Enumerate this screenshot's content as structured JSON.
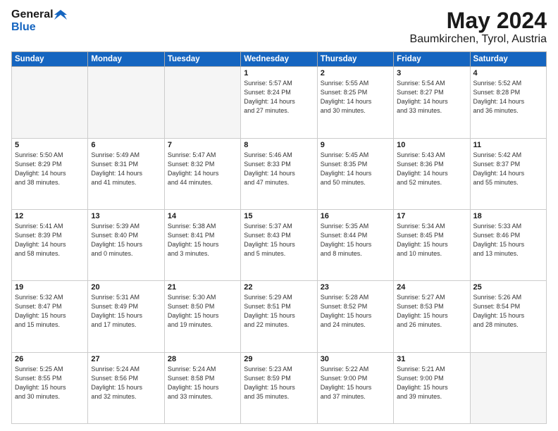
{
  "logo": {
    "text_general": "General",
    "text_blue": "Blue"
  },
  "header": {
    "title": "May 2024",
    "subtitle": "Baumkirchen, Tyrol, Austria"
  },
  "weekdays": [
    "Sunday",
    "Monday",
    "Tuesday",
    "Wednesday",
    "Thursday",
    "Friday",
    "Saturday"
  ],
  "weeks": [
    [
      {
        "day": "",
        "info": ""
      },
      {
        "day": "",
        "info": ""
      },
      {
        "day": "",
        "info": ""
      },
      {
        "day": "1",
        "info": "Sunrise: 5:57 AM\nSunset: 8:24 PM\nDaylight: 14 hours\nand 27 minutes."
      },
      {
        "day": "2",
        "info": "Sunrise: 5:55 AM\nSunset: 8:25 PM\nDaylight: 14 hours\nand 30 minutes."
      },
      {
        "day": "3",
        "info": "Sunrise: 5:54 AM\nSunset: 8:27 PM\nDaylight: 14 hours\nand 33 minutes."
      },
      {
        "day": "4",
        "info": "Sunrise: 5:52 AM\nSunset: 8:28 PM\nDaylight: 14 hours\nand 36 minutes."
      }
    ],
    [
      {
        "day": "5",
        "info": "Sunrise: 5:50 AM\nSunset: 8:29 PM\nDaylight: 14 hours\nand 38 minutes."
      },
      {
        "day": "6",
        "info": "Sunrise: 5:49 AM\nSunset: 8:31 PM\nDaylight: 14 hours\nand 41 minutes."
      },
      {
        "day": "7",
        "info": "Sunrise: 5:47 AM\nSunset: 8:32 PM\nDaylight: 14 hours\nand 44 minutes."
      },
      {
        "day": "8",
        "info": "Sunrise: 5:46 AM\nSunset: 8:33 PM\nDaylight: 14 hours\nand 47 minutes."
      },
      {
        "day": "9",
        "info": "Sunrise: 5:45 AM\nSunset: 8:35 PM\nDaylight: 14 hours\nand 50 minutes."
      },
      {
        "day": "10",
        "info": "Sunrise: 5:43 AM\nSunset: 8:36 PM\nDaylight: 14 hours\nand 52 minutes."
      },
      {
        "day": "11",
        "info": "Sunrise: 5:42 AM\nSunset: 8:37 PM\nDaylight: 14 hours\nand 55 minutes."
      }
    ],
    [
      {
        "day": "12",
        "info": "Sunrise: 5:41 AM\nSunset: 8:39 PM\nDaylight: 14 hours\nand 58 minutes."
      },
      {
        "day": "13",
        "info": "Sunrise: 5:39 AM\nSunset: 8:40 PM\nDaylight: 15 hours\nand 0 minutes."
      },
      {
        "day": "14",
        "info": "Sunrise: 5:38 AM\nSunset: 8:41 PM\nDaylight: 15 hours\nand 3 minutes."
      },
      {
        "day": "15",
        "info": "Sunrise: 5:37 AM\nSunset: 8:43 PM\nDaylight: 15 hours\nand 5 minutes."
      },
      {
        "day": "16",
        "info": "Sunrise: 5:35 AM\nSunset: 8:44 PM\nDaylight: 15 hours\nand 8 minutes."
      },
      {
        "day": "17",
        "info": "Sunrise: 5:34 AM\nSunset: 8:45 PM\nDaylight: 15 hours\nand 10 minutes."
      },
      {
        "day": "18",
        "info": "Sunrise: 5:33 AM\nSunset: 8:46 PM\nDaylight: 15 hours\nand 13 minutes."
      }
    ],
    [
      {
        "day": "19",
        "info": "Sunrise: 5:32 AM\nSunset: 8:47 PM\nDaylight: 15 hours\nand 15 minutes."
      },
      {
        "day": "20",
        "info": "Sunrise: 5:31 AM\nSunset: 8:49 PM\nDaylight: 15 hours\nand 17 minutes."
      },
      {
        "day": "21",
        "info": "Sunrise: 5:30 AM\nSunset: 8:50 PM\nDaylight: 15 hours\nand 19 minutes."
      },
      {
        "day": "22",
        "info": "Sunrise: 5:29 AM\nSunset: 8:51 PM\nDaylight: 15 hours\nand 22 minutes."
      },
      {
        "day": "23",
        "info": "Sunrise: 5:28 AM\nSunset: 8:52 PM\nDaylight: 15 hours\nand 24 minutes."
      },
      {
        "day": "24",
        "info": "Sunrise: 5:27 AM\nSunset: 8:53 PM\nDaylight: 15 hours\nand 26 minutes."
      },
      {
        "day": "25",
        "info": "Sunrise: 5:26 AM\nSunset: 8:54 PM\nDaylight: 15 hours\nand 28 minutes."
      }
    ],
    [
      {
        "day": "26",
        "info": "Sunrise: 5:25 AM\nSunset: 8:55 PM\nDaylight: 15 hours\nand 30 minutes."
      },
      {
        "day": "27",
        "info": "Sunrise: 5:24 AM\nSunset: 8:56 PM\nDaylight: 15 hours\nand 32 minutes."
      },
      {
        "day": "28",
        "info": "Sunrise: 5:24 AM\nSunset: 8:58 PM\nDaylight: 15 hours\nand 33 minutes."
      },
      {
        "day": "29",
        "info": "Sunrise: 5:23 AM\nSunset: 8:59 PM\nDaylight: 15 hours\nand 35 minutes."
      },
      {
        "day": "30",
        "info": "Sunrise: 5:22 AM\nSunset: 9:00 PM\nDaylight: 15 hours\nand 37 minutes."
      },
      {
        "day": "31",
        "info": "Sunrise: 5:21 AM\nSunset: 9:00 PM\nDaylight: 15 hours\nand 39 minutes."
      },
      {
        "day": "",
        "info": ""
      }
    ]
  ]
}
